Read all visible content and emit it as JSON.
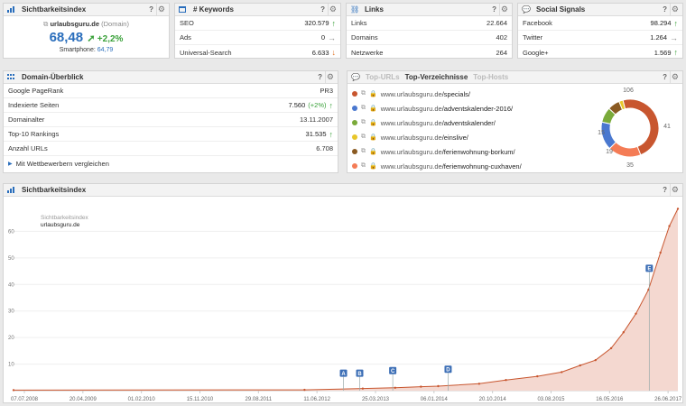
{
  "visibility_panel": {
    "title": "Sichtbarkeitsindex",
    "domain": "urlaubsguru.de",
    "domain_tag": "(Domain)",
    "value": "68,48",
    "change": "+2,2%",
    "smartphone_label": "Smartphone:",
    "smartphone_value": "64,79",
    "help": "?"
  },
  "keywords_panel": {
    "title": "# Keywords",
    "help": "?",
    "rows": [
      {
        "label": "SEO",
        "value": "320.579",
        "trend": "up"
      },
      {
        "label": "Ads",
        "value": "0",
        "trend": "right"
      },
      {
        "label": "Universal-Search",
        "value": "6.633",
        "trend": "down"
      }
    ]
  },
  "links_panel": {
    "title": "Links",
    "help": "?",
    "rows": [
      {
        "label": "Links",
        "value": "22.664"
      },
      {
        "label": "Domains",
        "value": "402"
      },
      {
        "label": "Netzwerke",
        "value": "264"
      }
    ]
  },
  "social_panel": {
    "title": "Social Signals",
    "help": "?",
    "rows": [
      {
        "label": "Facebook",
        "value": "98.294",
        "trend": "up"
      },
      {
        "label": "Twitter",
        "value": "1.264",
        "trend": "right"
      },
      {
        "label": "Google+",
        "value": "1.569",
        "trend": "up"
      }
    ]
  },
  "overview_panel": {
    "title": "Domain-Überblick",
    "help": "?",
    "rows": [
      {
        "label": "Google PageRank",
        "value": "PR3",
        "extra": "",
        "trend": ""
      },
      {
        "label": "Indexierte Seiten",
        "value": "7.560",
        "extra": "(+2%)",
        "trend": "up"
      },
      {
        "label": "Domainalter",
        "value": "13.11.2007",
        "extra": "",
        "trend": ""
      },
      {
        "label": "Top-10 Rankings",
        "value": "31.535",
        "extra": "",
        "trend": "up"
      },
      {
        "label": "Anzahl URLs",
        "value": "6.708",
        "extra": "",
        "trend": ""
      }
    ],
    "compare_link": "Mit Wettbewerbern vergleichen"
  },
  "directories_panel": {
    "tabs": [
      "Top-URLs",
      "Top-Verzeichnisse",
      "Top-Hosts"
    ],
    "active_tab": 1,
    "help": "?",
    "dirs": [
      {
        "prefix": "www.urlaubsguru.de",
        "path": "/specials/",
        "color": "#c8562f"
      },
      {
        "prefix": "www.urlaubsguru.de",
        "path": "/adventskalender-2016/",
        "color": "#4a78cf"
      },
      {
        "prefix": "www.urlaubsguru.de",
        "path": "/adventskalender/",
        "color": "#7aaa3a"
      },
      {
        "prefix": "www.urlaubsguru.de",
        "path": "/einslive/",
        "color": "#e8c62a"
      },
      {
        "prefix": "www.urlaubsguru.de",
        "path": "/ferienwohnung-borkum/",
        "color": "#8a5a22"
      },
      {
        "prefix": "www.urlaubsguru.de",
        "path": "/ferienwohnung-cuxhaven/",
        "color": "#f47c56"
      }
    ],
    "donut": {
      "segments": [
        {
          "value": 106,
          "color": "#c8562f"
        },
        {
          "value": 41,
          "color": "#f47c56"
        },
        {
          "value": 35,
          "color": "#4a78cf"
        },
        {
          "value": 19,
          "color": "#7aaa3a"
        },
        {
          "value": 15,
          "color": "#8a5a22"
        },
        {
          "value": 5,
          "color": "#e8c62a"
        }
      ],
      "labels": [
        "106",
        "41",
        "35",
        "19",
        "15"
      ]
    }
  },
  "chart_panel": {
    "title": "Sichtbarkeitsindex",
    "help": "?",
    "legend_title": "Sichtbarkeitsindex",
    "legend_series": "urlaubsguru.de"
  },
  "chart_data": {
    "type": "area",
    "x_tick_labels": [
      "07.07.2008",
      "20.04.2009",
      "01.02.2010",
      "15.11.2010",
      "29.08.2011",
      "11.06.2012",
      "25.03.2013",
      "06.01.2014",
      "20.10.2014",
      "03.08.2015",
      "16.05.2016",
      "26.06.2017"
    ],
    "y_ticks": [
      10,
      20,
      30,
      40,
      50,
      60
    ],
    "ylim": [
      0,
      70
    ],
    "series": [
      {
        "name": "urlaubsguru.de",
        "color": "#c8562f",
        "fill": "#f4d8d0",
        "x": [
          "2008-07-07",
          "2012-06-11",
          "2013-03-25",
          "2013-09-01",
          "2014-01-06",
          "2014-04-01",
          "2014-10-20",
          "2015-03-01",
          "2015-08-03",
          "2015-12-01",
          "2016-03-01",
          "2016-05-16",
          "2016-08-01",
          "2016-10-01",
          "2016-12-01",
          "2017-02-01",
          "2017-04-01",
          "2017-05-15",
          "2017-06-26"
        ],
        "y": [
          0.2,
          0.3,
          0.8,
          1.1,
          1.5,
          1.7,
          2.6,
          4.0,
          5.4,
          7.0,
          9.5,
          11.5,
          16.0,
          22.0,
          29.0,
          38.0,
          52.0,
          62.0,
          68.5
        ]
      }
    ],
    "events": [
      {
        "label": "A",
        "x": "2012-12-20",
        "y": 2.5
      },
      {
        "label": "B",
        "x": "2013-03-10",
        "y": 2.5
      },
      {
        "label": "C",
        "x": "2013-08-20",
        "y": 3.5
      },
      {
        "label": "D",
        "x": "2014-05-20",
        "y": 4.0
      },
      {
        "label": "E",
        "x": "2017-02-05",
        "y": 42.0
      }
    ]
  }
}
